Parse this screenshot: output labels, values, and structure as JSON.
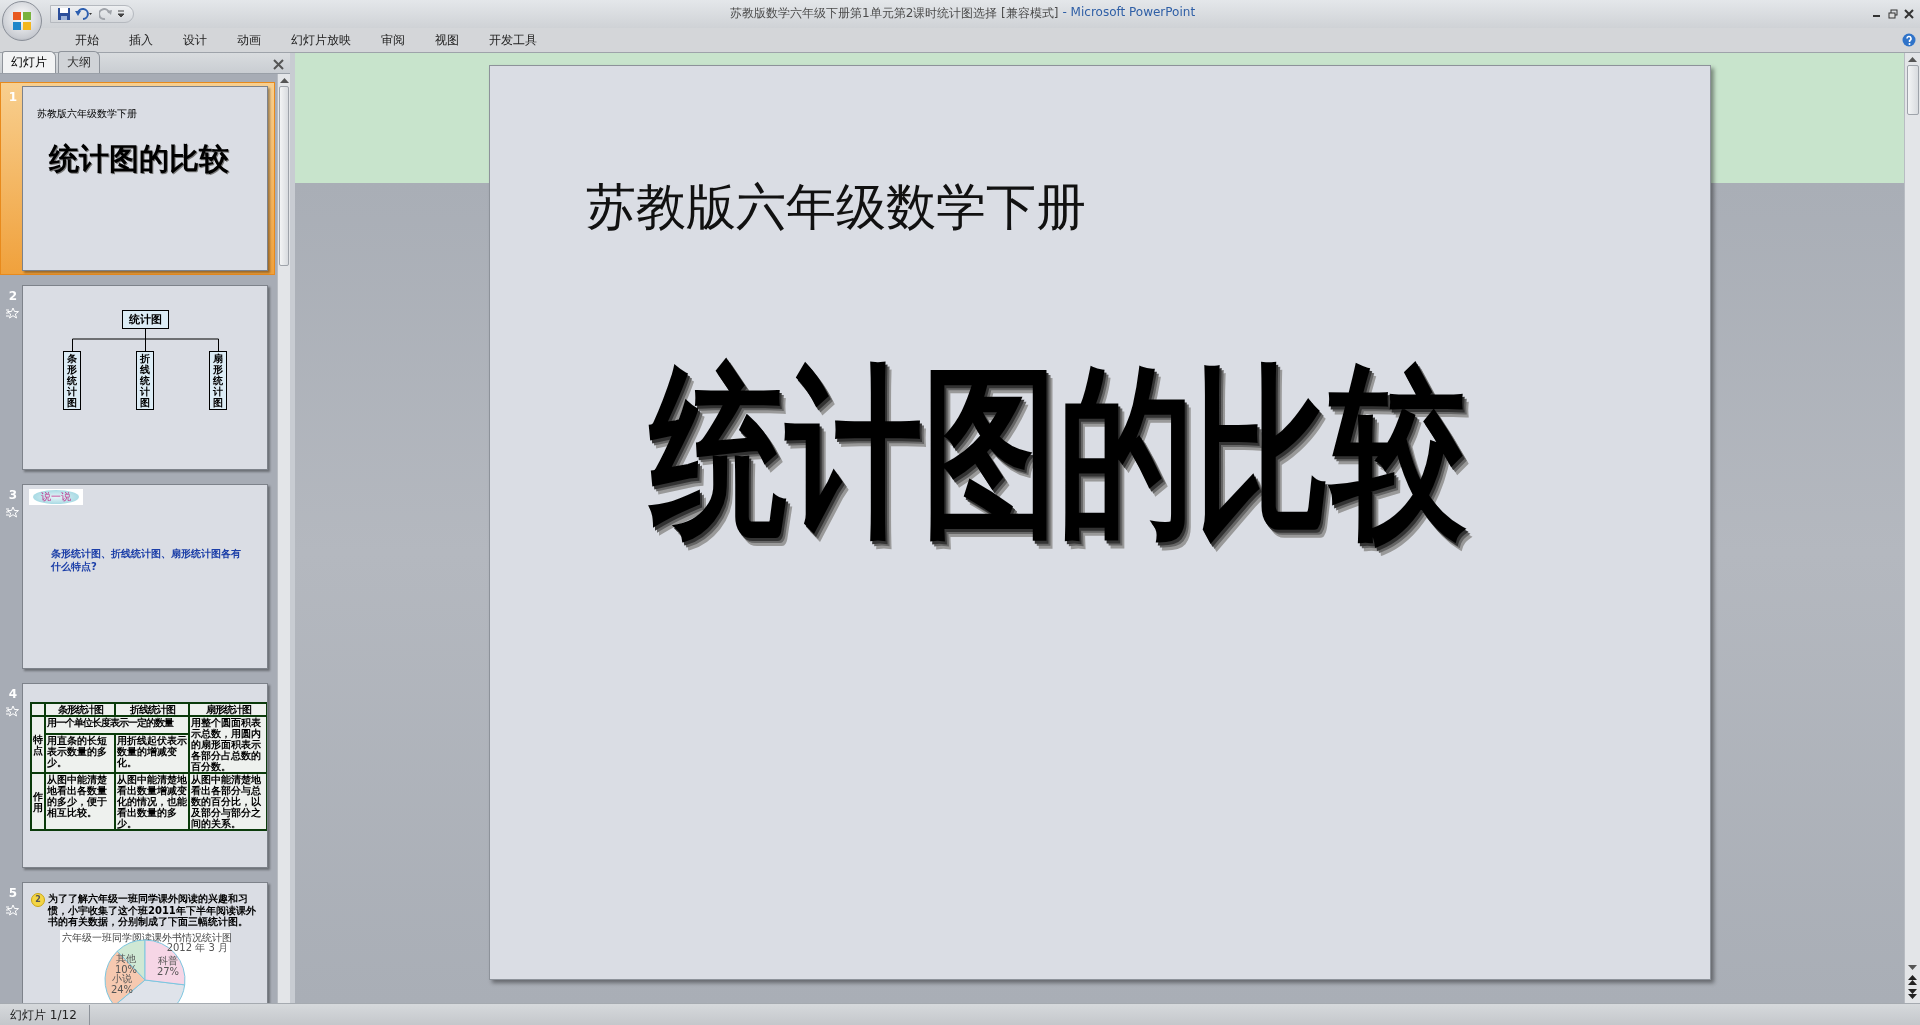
{
  "window": {
    "title": "苏教版数学六年级下册第1单元第2课时统计图选择 [兼容模式]",
    "app_name": "- Microsoft PowerPoint"
  },
  "ribbon_tabs": [
    "开始",
    "插入",
    "设计",
    "动画",
    "幻灯片放映",
    "审阅",
    "视图",
    "开发工具"
  ],
  "pane_tabs": [
    {
      "label": "幻灯片",
      "selected": true
    },
    {
      "label": "大纲",
      "selected": false
    }
  ],
  "thumbnails": [
    {
      "number": "1",
      "kind": "title",
      "selected": true,
      "animated": false,
      "subtitle": "苏教版六年级数学下册",
      "title": "统计图的比较"
    },
    {
      "number": "2",
      "kind": "org_chart",
      "selected": false,
      "animated": true,
      "root": "统计图",
      "children": [
        "条形统计图",
        "折线统计图",
        "扇形统计图"
      ]
    },
    {
      "number": "3",
      "kind": "question",
      "selected": false,
      "animated": true,
      "badge": "说一说",
      "question": "条形统计图、折线统计图、扇形统计图各有什么特点?"
    },
    {
      "number": "4",
      "kind": "table",
      "selected": false,
      "animated": true,
      "headers": [
        "条形统计图",
        "折线统计图",
        "扇形统计图"
      ],
      "row_labels": [
        "特点",
        "作用"
      ],
      "common_feature": "用一个单位长度表示一定的数量",
      "features": [
        "用直条的长短表示数量的多少。",
        "用折线起伏表示数量的增减变化。",
        "用整个圆面积表示总数，用圆内的扇形面积表示各部分占总数的百分数。"
      ],
      "uses": [
        "从图中能清楚地看出各数量的多少，便于相互比较。",
        "从图中能清楚地看出数量增减变化的情况，也能看出数量的多少。",
        "从图中能清楚地看出各部分与总数的百分比，以及部分与部分之间的关系。"
      ]
    },
    {
      "number": "5",
      "kind": "text_chart",
      "selected": false,
      "animated": true,
      "badge": "2",
      "text": "为了了解六年级一班同学课外阅读的兴趣和习惯，小宇收集了这个班2011年下半年阅读课外书的有关数据，分别制成了下面三幅统计图。",
      "chart_title": "六年级一班同学阅读课外书情况统计图",
      "chart_date": "2012 年 3 月",
      "pie_labels": [
        {
          "name": "其他",
          "share": "10%",
          "color": "#cfe8d4"
        },
        {
          "name": "科普",
          "share": "27%",
          "color": "#f6d6e6"
        },
        {
          "name": "小说",
          "share": "24%",
          "color": "#f6c9b0"
        }
      ]
    }
  ],
  "slide": {
    "subtitle": "苏教版六年级数学下册",
    "title": "统计图的比较"
  },
  "status_bar": {
    "slide_indicator": "幻灯片 1/12"
  }
}
